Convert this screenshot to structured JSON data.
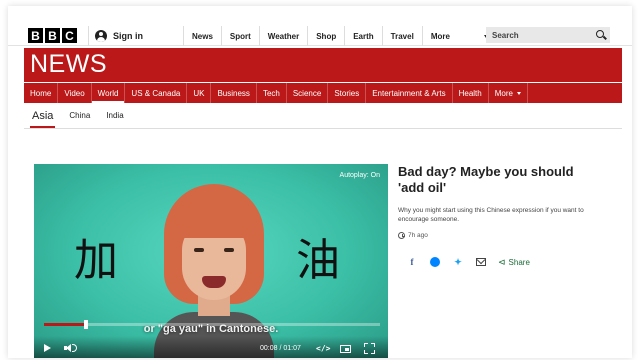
{
  "header": {
    "logo_letters": [
      "B",
      "B",
      "C"
    ],
    "signin_label": "Sign in",
    "nav": [
      "News",
      "Sport",
      "Weather",
      "Shop",
      "Earth",
      "Travel"
    ],
    "more_label": "More",
    "search_placeholder": "Search"
  },
  "masthead": {
    "title": "NEWS",
    "color": "#bb1919"
  },
  "main_nav": {
    "items": [
      "Home",
      "Video",
      "World",
      "US & Canada",
      "UK",
      "Business",
      "Tech",
      "Science",
      "Stories",
      "Entertainment & Arts",
      "Health"
    ],
    "more_label": "More",
    "active": "World"
  },
  "sub_nav": {
    "items": [
      "Asia",
      "China",
      "India"
    ],
    "active": "Asia"
  },
  "video": {
    "autoplay_label": "Autoplay: On",
    "char_left": "加",
    "char_right": "油",
    "subtitle": "or \"ga yau\" in Cantonese.",
    "time": "00:08 / 01:07",
    "progress": 0.12,
    "embed_label": "</>"
  },
  "article": {
    "headline": "Bad day? Maybe you should 'add oil'",
    "summary": "Why you might start using this Chinese expression if you want to encourage someone.",
    "timestamp": "7h ago",
    "share_label": "Share",
    "share_icons": [
      "facebook-icon",
      "messenger-icon",
      "twitter-icon",
      "email-icon"
    ]
  }
}
